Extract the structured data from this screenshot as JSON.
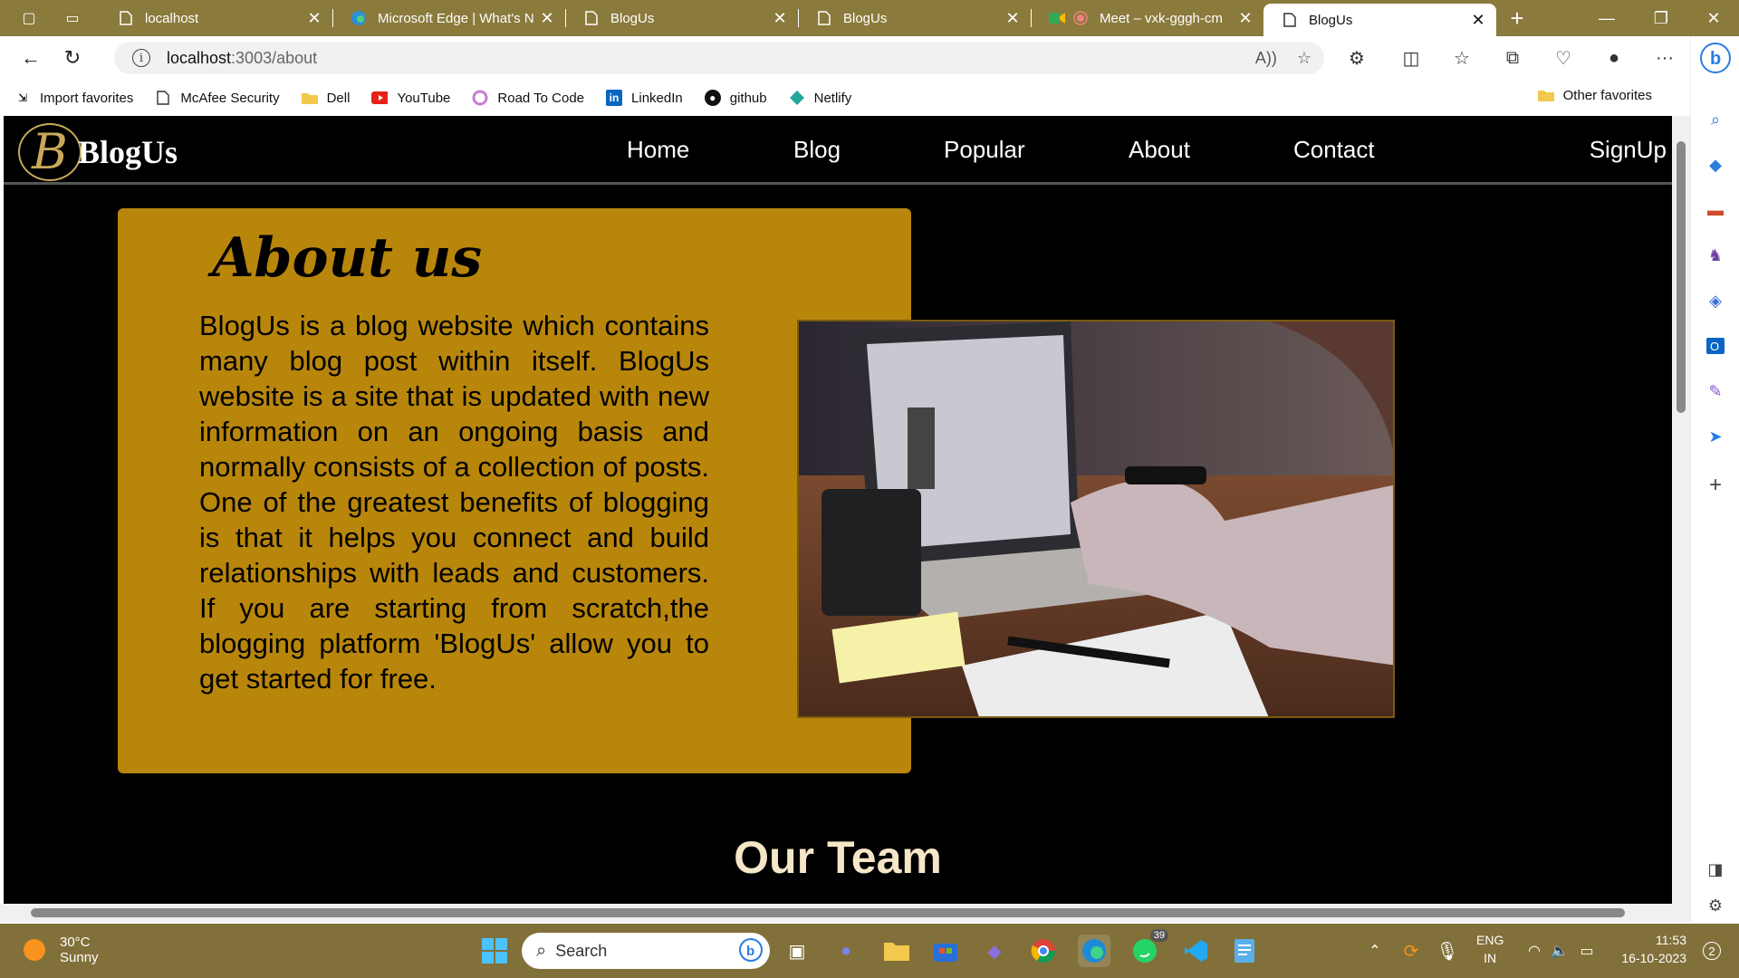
{
  "browser": {
    "tabs": [
      {
        "title": "localhost",
        "active": false
      },
      {
        "title": "Microsoft Edge | What's N",
        "active": false
      },
      {
        "title": "BlogUs",
        "active": false
      },
      {
        "title": "BlogUs",
        "active": false
      },
      {
        "title": "Meet – vxk-gggh-cm",
        "active": false
      },
      {
        "title": "BlogUs",
        "active": true
      }
    ],
    "url_host": "localhost",
    "url_path": ":3003/about",
    "favorites": [
      "Import favorites",
      "McAfee Security",
      "Dell",
      "YouTube",
      "Road To Code",
      "LinkedIn",
      "github",
      "Netlify"
    ],
    "other_favorites": "Other favorites"
  },
  "site": {
    "logo_mark": "B",
    "logo_text": "BlogUs",
    "nav": [
      "Home",
      "Blog",
      "Popular",
      "About",
      "Contact"
    ],
    "signup": "SignUp"
  },
  "about": {
    "title": "About us",
    "text": "BlogUs is a blog website which contains many blog post within itself. BlogUs website is a site that is updated with new information on an ongoing basis and normally consists of a collection of posts. One of the greatest benefits of blogging is that it helps you connect and build relationships with leads and customers. If you are starting from scratch,the blogging platform 'BlogUs' allow you to get started for free."
  },
  "team": {
    "title": "Our Team"
  },
  "taskbar": {
    "temp": "30°C",
    "condition": "Sunny",
    "search": "Search",
    "whatsapp_badge": "39",
    "lang_1": "ENG",
    "lang_2": "IN",
    "time": "11:53",
    "date": "16-10-2023",
    "notif": "2"
  },
  "colors": {
    "accent": "#b8860b",
    "tabstrip": "#8a7a3c",
    "taskbar": "#82703a"
  }
}
